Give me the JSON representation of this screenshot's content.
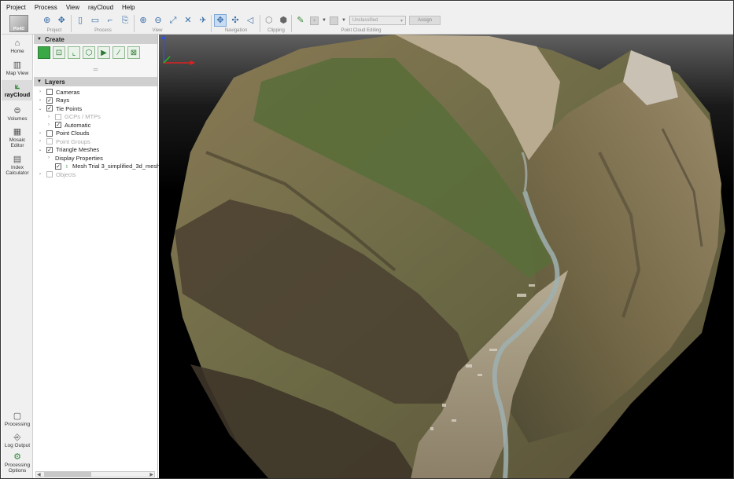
{
  "menu": [
    "Project",
    "Process",
    "View",
    "rayCloud",
    "Help"
  ],
  "toolbar": {
    "logo_text": "Pix4D",
    "groups": {
      "project": "Project",
      "process": "Process",
      "view": "View",
      "navigation": "Navigation",
      "clipping": "Clipping",
      "point_cloud_editing": "Point Cloud Editing"
    },
    "class_select_value": "Unclassified",
    "assign_label": "Assign",
    "plus_label": "+"
  },
  "leftnav": {
    "home": "Home",
    "map_view": "Map View",
    "raycloud": "rayCloud",
    "volumes": "Volumes",
    "mosaic_editor": "Mosaic Editor",
    "index_calculator": "Index Calculator",
    "processing": "Processing",
    "log_output": "Log Output",
    "processing_options": "Processing Options"
  },
  "panel": {
    "create_title": "Create",
    "layers_title": "Layers"
  },
  "layers": [
    {
      "label": "Cameras",
      "checked": false,
      "expander": ">",
      "indent": 0,
      "dim": false
    },
    {
      "label": "Rays",
      "checked": true,
      "expander": ">",
      "indent": 0,
      "dim": false
    },
    {
      "label": "Tie Points",
      "checked": true,
      "expander": "v",
      "indent": 0,
      "dim": false
    },
    {
      "label": "GCPs / MTPs",
      "checked": false,
      "expander": ">",
      "indent": 1,
      "dim": true
    },
    {
      "label": "Automatic",
      "checked": true,
      "expander": ">",
      "indent": 1,
      "dim": false
    },
    {
      "label": "Point Clouds",
      "checked": false,
      "expander": ">",
      "indent": 0,
      "dim": false
    },
    {
      "label": "Point Groups",
      "checked": false,
      "expander": ">",
      "indent": 0,
      "dim": true
    },
    {
      "label": "Triangle Meshes",
      "checked": true,
      "expander": "v",
      "indent": 0,
      "dim": false
    },
    {
      "label": "Display Properties",
      "checked": null,
      "expander": ">",
      "indent": 1,
      "dim": false
    },
    {
      "label": "Mesh Trial 3_simplified_3d_mesh",
      "checked": true,
      "expander": "",
      "indent": 1,
      "dim": false
    },
    {
      "label": "Objects",
      "checked": false,
      "expander": ">",
      "indent": 0,
      "dim": true
    }
  ],
  "colors": {
    "accent": "#3a6fa8",
    "create_green": "#3aa845",
    "panel_header": "#cfcfcf",
    "axis_x": "#e02020",
    "axis_y": "#20c020",
    "axis_z": "#3050e0"
  }
}
